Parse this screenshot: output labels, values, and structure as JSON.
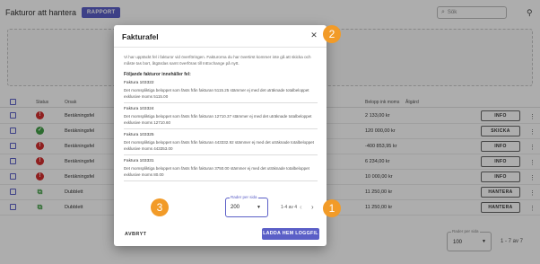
{
  "app": {
    "title": "Fakturor att hantera",
    "report_label": "RAPPORT",
    "search_placeholder": "Sök"
  },
  "table": {
    "headers": [
      "Status",
      "Orsak",
      "Belopp ink moms",
      "Åtgärd"
    ],
    "rows": [
      {
        "status": "error",
        "reason": "Beräkningsfel",
        "amount": "2 133,00 kr",
        "action": "INFO"
      },
      {
        "status": "ok",
        "reason": "Beräkningsfel",
        "amount": "120 000,00 kr",
        "action": "SKICKA"
      },
      {
        "status": "error",
        "reason": "Beräkningsfel",
        "amount": "-400 853,95 kr",
        "action": "INFO"
      },
      {
        "status": "error",
        "reason": "Beräkningsfel",
        "amount": "6 234,00 kr",
        "action": "INFO"
      },
      {
        "status": "error",
        "reason": "Beräkningsfel",
        "amount": "10 000,00 kr",
        "action": "INFO"
      },
      {
        "status": "duplicate",
        "reason": "Dubblett",
        "amount": "11 250,00 kr",
        "action": "HANTERA"
      },
      {
        "status": "duplicate",
        "reason": "Dubblett",
        "amount": "11 250,00 kr",
        "action": "HANTERA"
      }
    ],
    "pager": {
      "rows_label": "Rader per sida",
      "rows_value": "100",
      "range": "1 - 7 av 7"
    }
  },
  "modal": {
    "title": "Fakturafel",
    "intro": "Vi har upptäckt fel i fakturor vid överföringen. Fakturorna du har övertirst kommer inte gå att skicka och måste tas bort, åtgärdas samt överföras till InExchange på nytt.",
    "list_heading": "Följande fakturor innehåller fel:",
    "errors": [
      {
        "invoice": "Faktura 103322",
        "message": "Det momspliktiga beloppet som fästs från fakturan 5115.25 stämmer ej med det uträknade totalbeloppet exklusive moms 5115.00"
      },
      {
        "invoice": "Faktura 103324",
        "message": "Det momspliktiga beloppet som fästs från fakturan 12710.37 stämmer ej med det uträknade totalbeloppet exklusive moms 12710.60"
      },
      {
        "invoice": "Faktura 103325",
        "message": "Det momspliktiga beloppet som fästs från fakturan 443332.92 stämmer ej med det uträknade totalbeloppet exklusive moms 443353.00"
      },
      {
        "invoice": "Faktura 103331",
        "message": "Det momspliktiga beloppet som fästs från fakturan 3750.00 stämmer ej med det uträknade totalbeloppet exklusive moms 80.00"
      }
    ],
    "pager": {
      "rows_label": "Rader per sida",
      "rows_value": "200",
      "range": "1-4 av 4"
    },
    "cancel_label": "AVBRYT",
    "download_label": "LADDA HEM LOGGFIL"
  },
  "callouts": {
    "download": "1",
    "close": "2",
    "cancel": "3"
  },
  "colors": {
    "accent": "#5b5fc7",
    "callout": "#f29b28",
    "error": "#d32f2f",
    "ok": "#43a047"
  }
}
